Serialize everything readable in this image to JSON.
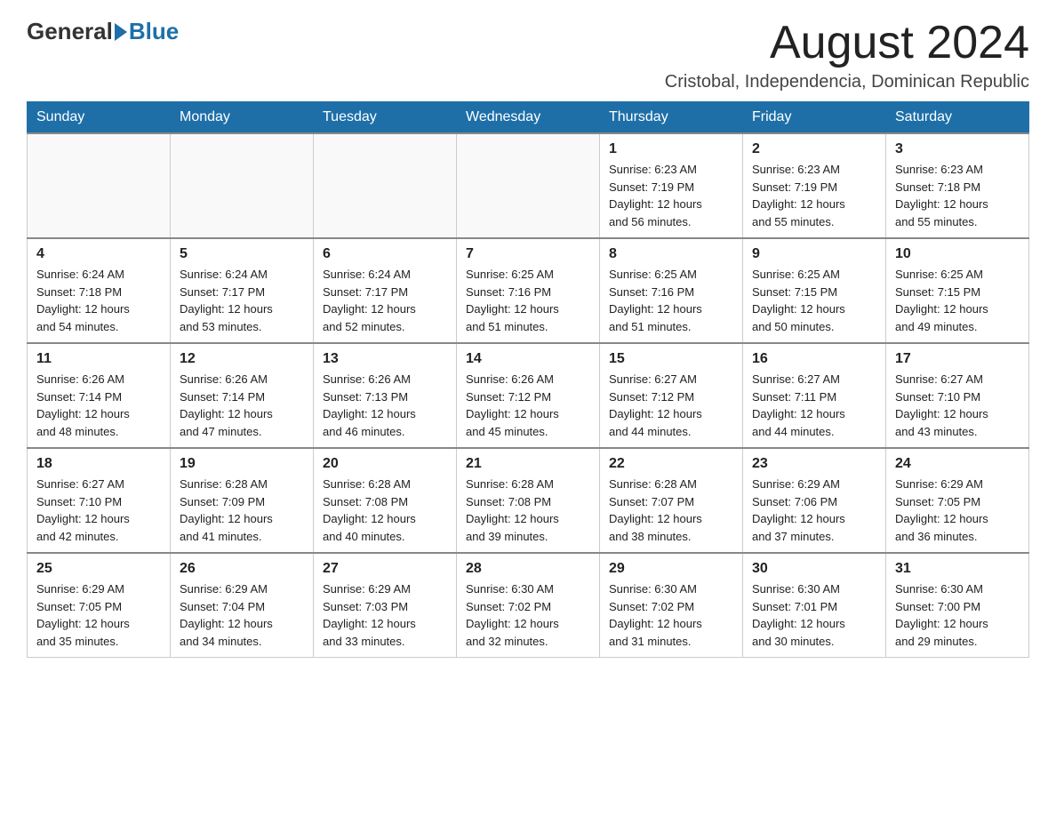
{
  "header": {
    "logo_general": "General",
    "logo_blue": "Blue",
    "month_title": "August 2024",
    "subtitle": "Cristobal, Independencia, Dominican Republic"
  },
  "days_of_week": [
    "Sunday",
    "Monday",
    "Tuesday",
    "Wednesday",
    "Thursday",
    "Friday",
    "Saturday"
  ],
  "weeks": [
    {
      "days": [
        {
          "number": "",
          "info": ""
        },
        {
          "number": "",
          "info": ""
        },
        {
          "number": "",
          "info": ""
        },
        {
          "number": "",
          "info": ""
        },
        {
          "number": "1",
          "info": "Sunrise: 6:23 AM\nSunset: 7:19 PM\nDaylight: 12 hours\nand 56 minutes."
        },
        {
          "number": "2",
          "info": "Sunrise: 6:23 AM\nSunset: 7:19 PM\nDaylight: 12 hours\nand 55 minutes."
        },
        {
          "number": "3",
          "info": "Sunrise: 6:23 AM\nSunset: 7:18 PM\nDaylight: 12 hours\nand 55 minutes."
        }
      ]
    },
    {
      "days": [
        {
          "number": "4",
          "info": "Sunrise: 6:24 AM\nSunset: 7:18 PM\nDaylight: 12 hours\nand 54 minutes."
        },
        {
          "number": "5",
          "info": "Sunrise: 6:24 AM\nSunset: 7:17 PM\nDaylight: 12 hours\nand 53 minutes."
        },
        {
          "number": "6",
          "info": "Sunrise: 6:24 AM\nSunset: 7:17 PM\nDaylight: 12 hours\nand 52 minutes."
        },
        {
          "number": "7",
          "info": "Sunrise: 6:25 AM\nSunset: 7:16 PM\nDaylight: 12 hours\nand 51 minutes."
        },
        {
          "number": "8",
          "info": "Sunrise: 6:25 AM\nSunset: 7:16 PM\nDaylight: 12 hours\nand 51 minutes."
        },
        {
          "number": "9",
          "info": "Sunrise: 6:25 AM\nSunset: 7:15 PM\nDaylight: 12 hours\nand 50 minutes."
        },
        {
          "number": "10",
          "info": "Sunrise: 6:25 AM\nSunset: 7:15 PM\nDaylight: 12 hours\nand 49 minutes."
        }
      ]
    },
    {
      "days": [
        {
          "number": "11",
          "info": "Sunrise: 6:26 AM\nSunset: 7:14 PM\nDaylight: 12 hours\nand 48 minutes."
        },
        {
          "number": "12",
          "info": "Sunrise: 6:26 AM\nSunset: 7:14 PM\nDaylight: 12 hours\nand 47 minutes."
        },
        {
          "number": "13",
          "info": "Sunrise: 6:26 AM\nSunset: 7:13 PM\nDaylight: 12 hours\nand 46 minutes."
        },
        {
          "number": "14",
          "info": "Sunrise: 6:26 AM\nSunset: 7:12 PM\nDaylight: 12 hours\nand 45 minutes."
        },
        {
          "number": "15",
          "info": "Sunrise: 6:27 AM\nSunset: 7:12 PM\nDaylight: 12 hours\nand 44 minutes."
        },
        {
          "number": "16",
          "info": "Sunrise: 6:27 AM\nSunset: 7:11 PM\nDaylight: 12 hours\nand 44 minutes."
        },
        {
          "number": "17",
          "info": "Sunrise: 6:27 AM\nSunset: 7:10 PM\nDaylight: 12 hours\nand 43 minutes."
        }
      ]
    },
    {
      "days": [
        {
          "number": "18",
          "info": "Sunrise: 6:27 AM\nSunset: 7:10 PM\nDaylight: 12 hours\nand 42 minutes."
        },
        {
          "number": "19",
          "info": "Sunrise: 6:28 AM\nSunset: 7:09 PM\nDaylight: 12 hours\nand 41 minutes."
        },
        {
          "number": "20",
          "info": "Sunrise: 6:28 AM\nSunset: 7:08 PM\nDaylight: 12 hours\nand 40 minutes."
        },
        {
          "number": "21",
          "info": "Sunrise: 6:28 AM\nSunset: 7:08 PM\nDaylight: 12 hours\nand 39 minutes."
        },
        {
          "number": "22",
          "info": "Sunrise: 6:28 AM\nSunset: 7:07 PM\nDaylight: 12 hours\nand 38 minutes."
        },
        {
          "number": "23",
          "info": "Sunrise: 6:29 AM\nSunset: 7:06 PM\nDaylight: 12 hours\nand 37 minutes."
        },
        {
          "number": "24",
          "info": "Sunrise: 6:29 AM\nSunset: 7:05 PM\nDaylight: 12 hours\nand 36 minutes."
        }
      ]
    },
    {
      "days": [
        {
          "number": "25",
          "info": "Sunrise: 6:29 AM\nSunset: 7:05 PM\nDaylight: 12 hours\nand 35 minutes."
        },
        {
          "number": "26",
          "info": "Sunrise: 6:29 AM\nSunset: 7:04 PM\nDaylight: 12 hours\nand 34 minutes."
        },
        {
          "number": "27",
          "info": "Sunrise: 6:29 AM\nSunset: 7:03 PM\nDaylight: 12 hours\nand 33 minutes."
        },
        {
          "number": "28",
          "info": "Sunrise: 6:30 AM\nSunset: 7:02 PM\nDaylight: 12 hours\nand 32 minutes."
        },
        {
          "number": "29",
          "info": "Sunrise: 6:30 AM\nSunset: 7:02 PM\nDaylight: 12 hours\nand 31 minutes."
        },
        {
          "number": "30",
          "info": "Sunrise: 6:30 AM\nSunset: 7:01 PM\nDaylight: 12 hours\nand 30 minutes."
        },
        {
          "number": "31",
          "info": "Sunrise: 6:30 AM\nSunset: 7:00 PM\nDaylight: 12 hours\nand 29 minutes."
        }
      ]
    }
  ]
}
